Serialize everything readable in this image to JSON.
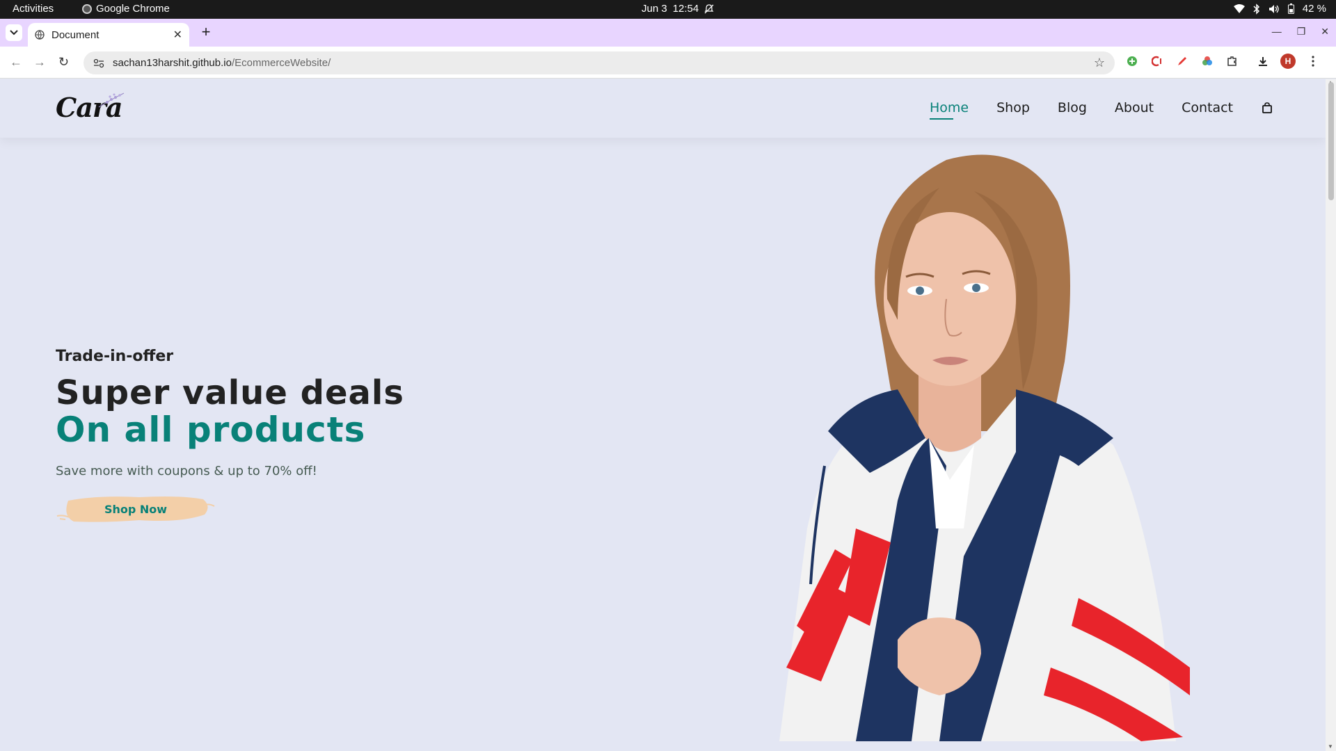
{
  "system_bar": {
    "activities": "Activities",
    "app_name": "Google Chrome",
    "date": "Jun 3",
    "time": "12:54",
    "battery": "42 %"
  },
  "browser": {
    "tab_title": "Document",
    "url_host": "sachan13harshit.github.io",
    "url_path": "/EcommerceWebsite/",
    "avatar_initial": "H",
    "tab_color": "#e8d5ff"
  },
  "site": {
    "logo": "Cara",
    "nav": [
      {
        "label": "Home",
        "active": true
      },
      {
        "label": "Shop"
      },
      {
        "label": "Blog"
      },
      {
        "label": "About"
      },
      {
        "label": "Contact"
      }
    ],
    "hero": {
      "kicker": "Trade-in-offer",
      "headline_1": "Super value deals",
      "headline_2": "On all products",
      "subtext": "Save more with coupons & up to 70% off!",
      "button_label": "Shop Now"
    },
    "colors": {
      "accent": "#088178",
      "background": "#e3e6f3",
      "button_brush": "#f3cfa8"
    }
  }
}
